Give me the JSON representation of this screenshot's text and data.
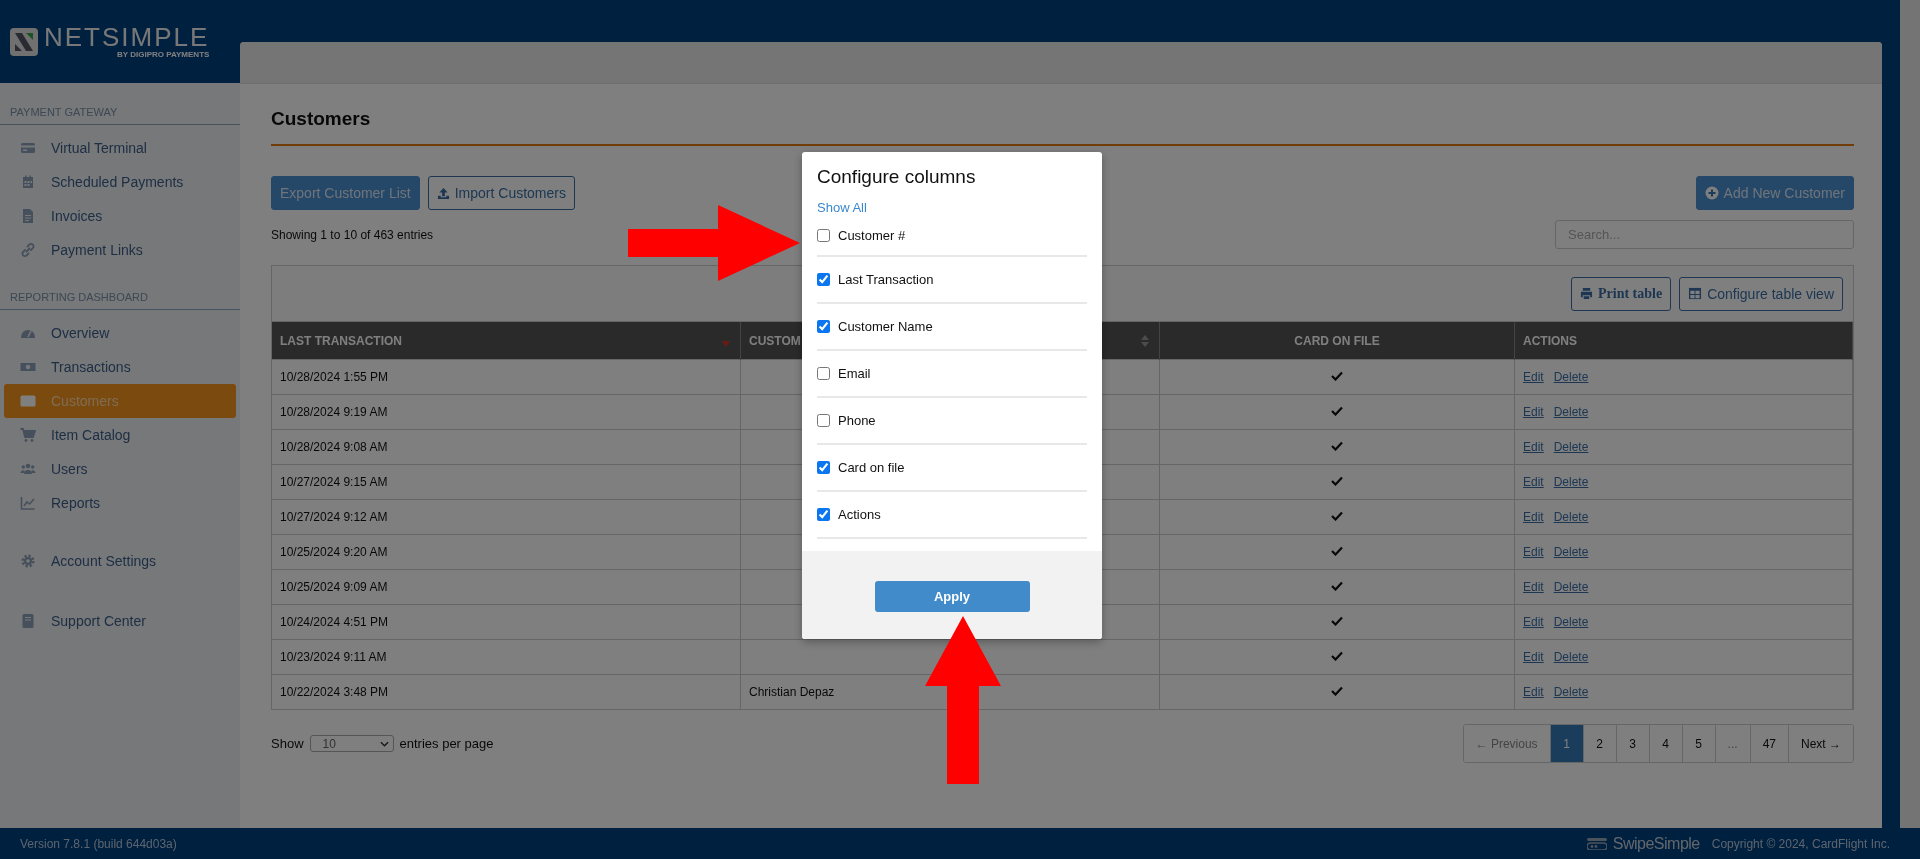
{
  "brand": {
    "name": "NETSIMPLE",
    "tagline": "BY DIGIPRO PAYMENTS"
  },
  "sidebar": {
    "sections": [
      {
        "title": "PAYMENT GATEWAY",
        "items": [
          {
            "label": "Virtual Terminal",
            "selected": false
          },
          {
            "label": "Scheduled Payments",
            "selected": false
          },
          {
            "label": "Invoices",
            "selected": false
          },
          {
            "label": "Payment Links",
            "selected": false
          }
        ]
      },
      {
        "title": "REPORTING DASHBOARD",
        "items": [
          {
            "label": "Overview",
            "selected": false
          },
          {
            "label": "Transactions",
            "selected": false
          },
          {
            "label": "Customers",
            "selected": true
          },
          {
            "label": "Item Catalog",
            "selected": false
          },
          {
            "label": "Users",
            "selected": false
          },
          {
            "label": "Reports",
            "selected": false
          }
        ]
      },
      {
        "items": [
          {
            "label": "Account Settings",
            "selected": false
          }
        ]
      },
      {
        "items": [
          {
            "label": "Support Center",
            "selected": false
          }
        ]
      }
    ]
  },
  "page": {
    "title": "Customers",
    "export_button": "Export Customer List",
    "import_button": "Import Customers",
    "add_button": "Add New Customer",
    "entries_info": "Showing 1 to 10 of 463 entries",
    "search": {
      "placeholder": "Search..."
    },
    "print_button": "Print table",
    "configure_button": "Configure table view"
  },
  "table": {
    "columns": [
      {
        "label": "LAST TRANSACTION"
      },
      {
        "label": "CUSTOM"
      },
      {
        "label": "CARD ON FILE"
      },
      {
        "label": "ACTIONS"
      }
    ],
    "rows": [
      {
        "last_transaction": "10/28/2024 1:55 PM",
        "card_on_file": true,
        "actions": [
          "Edit",
          "Delete"
        ]
      },
      {
        "last_transaction": "10/28/2024 9:19 AM",
        "card_on_file": true,
        "actions": [
          "Edit",
          "Delete"
        ]
      },
      {
        "last_transaction": "10/28/2024 9:08 AM",
        "card_on_file": true,
        "actions": [
          "Edit",
          "Delete"
        ]
      },
      {
        "last_transaction": "10/27/2024 9:15 AM",
        "card_on_file": true,
        "actions": [
          "Edit",
          "Delete"
        ]
      },
      {
        "last_transaction": "10/27/2024 9:12 AM",
        "card_on_file": true,
        "actions": [
          "Edit",
          "Delete"
        ]
      },
      {
        "last_transaction": "10/25/2024 9:20 AM",
        "card_on_file": true,
        "actions": [
          "Edit",
          "Delete"
        ]
      },
      {
        "last_transaction": "10/25/2024 9:09 AM",
        "card_on_file": true,
        "actions": [
          "Edit",
          "Delete"
        ]
      },
      {
        "last_transaction": "10/24/2024 4:51 PM",
        "card_on_file": true,
        "actions": [
          "Edit",
          "Delete"
        ]
      },
      {
        "last_transaction": "10/23/2024 9:11 AM",
        "card_on_file": true,
        "actions": [
          "Edit",
          "Delete"
        ]
      },
      {
        "last_transaction": "10/22/2024 3:48 PM",
        "customer_name": "Christian Depaz",
        "card_on_file": true,
        "actions": [
          "Edit",
          "Delete"
        ]
      }
    ]
  },
  "page_size": {
    "label_before": "Show",
    "value": "10",
    "label_after": "entries per page"
  },
  "pagination": [
    {
      "label": "← Previous",
      "selected": false,
      "disabled": true
    },
    {
      "label": "1",
      "selected": true,
      "disabled": false
    },
    {
      "label": "2",
      "selected": false,
      "disabled": false
    },
    {
      "label": "3",
      "selected": false,
      "disabled": false
    },
    {
      "label": "4",
      "selected": false,
      "disabled": false
    },
    {
      "label": "5",
      "selected": false,
      "disabled": false
    },
    {
      "label": "...",
      "selected": false,
      "disabled": true
    },
    {
      "label": "47",
      "selected": false,
      "disabled": false
    },
    {
      "label": "Next →",
      "selected": false,
      "disabled": false
    }
  ],
  "modal": {
    "title": "Configure columns",
    "show_all": "Show All",
    "options": [
      {
        "label": "Customer #",
        "checked": false
      },
      {
        "label": "Last Transaction",
        "checked": true
      },
      {
        "label": "Customer Name",
        "checked": true
      },
      {
        "label": "Email",
        "checked": false
      },
      {
        "label": "Phone",
        "checked": false
      },
      {
        "label": "Card on file",
        "checked": true
      },
      {
        "label": "Actions",
        "checked": true
      }
    ],
    "apply_button": "Apply"
  },
  "footer": {
    "version": "Version 7.8.1 (build 644d03a)",
    "brand": "SwipeSimple",
    "copyright": "Copyright © 2024, CardFlight Inc."
  }
}
